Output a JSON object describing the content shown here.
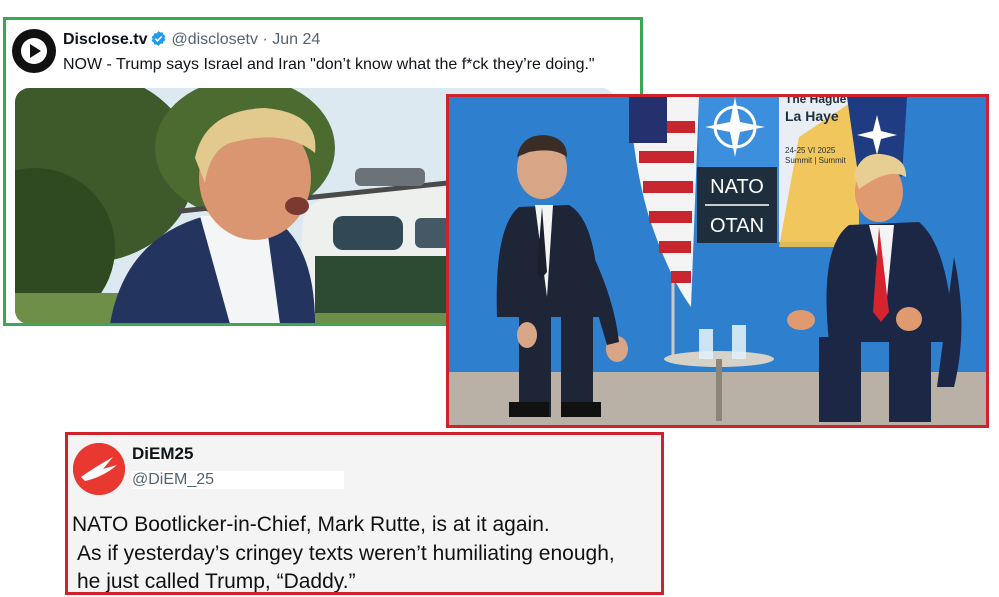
{
  "tweet1": {
    "name": "Disclose.tv",
    "handle": "@disclosetv",
    "separator": "·",
    "date": "Jun 24",
    "text": "NOW - Trump says Israel and Iran \"don’t know what the f*ck they’re doing.\"",
    "colors": {
      "frame": "#3aa757",
      "verified": "#1d9bf0"
    }
  },
  "photo2": {
    "flag_sign_lines": [
      "NATO",
      "OTAN"
    ],
    "backdrop_lines": [
      "The Hague",
      "La Haye",
      "24-25 VI 2025",
      "Summit | Summit"
    ],
    "colors": {
      "frame": "#d0222b",
      "backdrop": "#2f7fcf"
    }
  },
  "tweet2": {
    "name": "DiEM25",
    "handle": "@DiEM_25",
    "line1": "NATO Bootlicker-in-Chief, Mark Rutte, is at it again.",
    "line2": "As if yesterday’s cringey texts weren’t humiliating enough,",
    "line3": "he just called Trump, “Daddy.”",
    "colors": {
      "frame": "#d0222b",
      "avatar": "#e8382f"
    }
  }
}
